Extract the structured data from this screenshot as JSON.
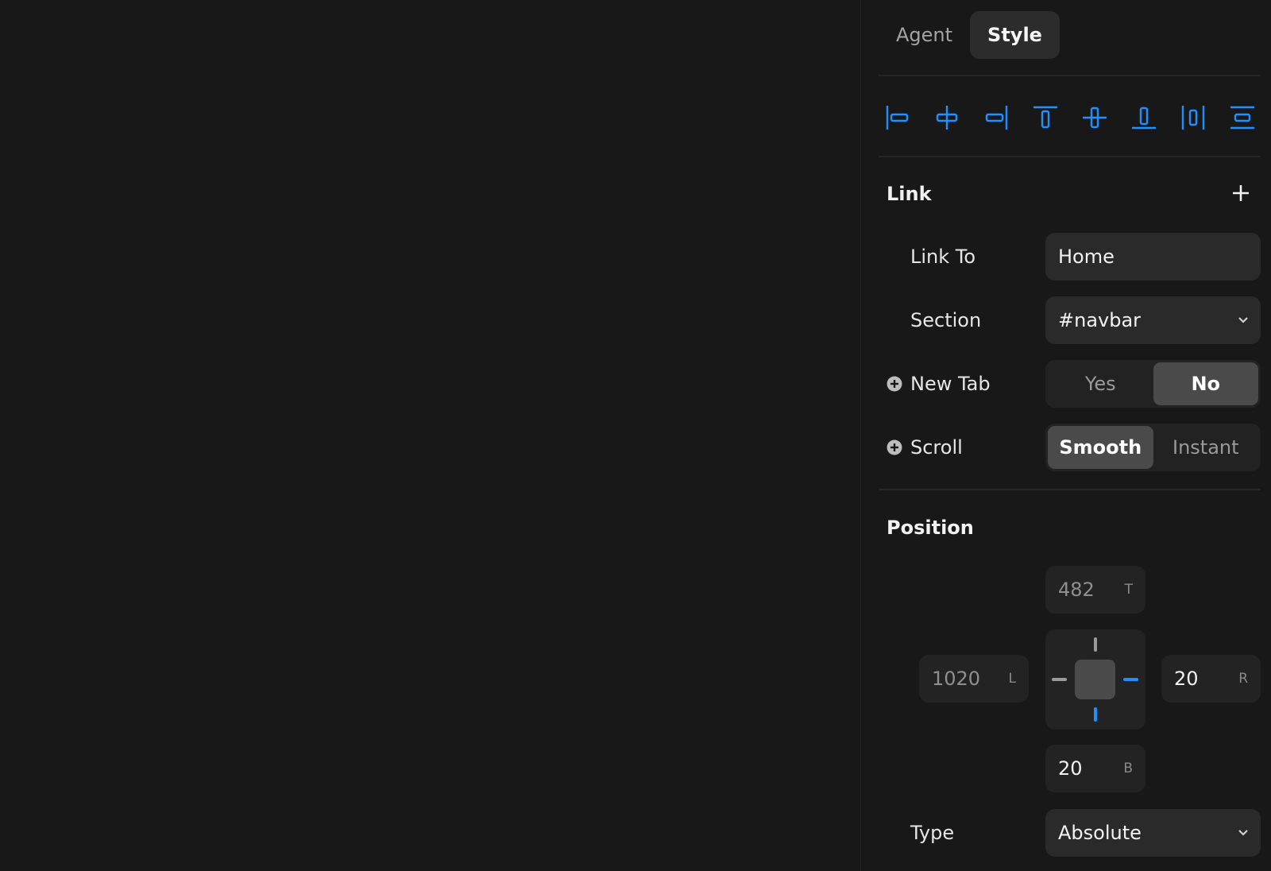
{
  "tabs": [
    {
      "label": "Agent",
      "active": false
    },
    {
      "label": "Style",
      "active": true
    }
  ],
  "alignment_icons": [
    "align-left-icon",
    "align-horizontal-center-icon",
    "align-right-icon",
    "align-top-icon",
    "align-vertical-center-icon",
    "align-bottom-icon",
    "distribute-horizontal-icon",
    "distribute-vertical-icon"
  ],
  "accent_color": "#1e90ff",
  "link": {
    "title": "Link",
    "link_to": {
      "label": "Link To",
      "value": "Home"
    },
    "section": {
      "label": "Section",
      "value": "#navbar"
    },
    "new_tab": {
      "label": "New Tab",
      "options": [
        "Yes",
        "No"
      ],
      "selected": "No"
    },
    "scroll": {
      "label": "Scroll",
      "options": [
        "Smooth",
        "Instant"
      ],
      "selected": "Smooth"
    }
  },
  "position": {
    "title": "Position",
    "top": {
      "value": "482",
      "suffix": "T"
    },
    "left": {
      "value": "1020",
      "suffix": "L"
    },
    "right": {
      "value": "20",
      "suffix": "R"
    },
    "bottom": {
      "value": "20",
      "suffix": "B"
    },
    "pinned_sides": [
      "right",
      "bottom"
    ],
    "type": {
      "label": "Type",
      "value": "Absolute"
    }
  }
}
